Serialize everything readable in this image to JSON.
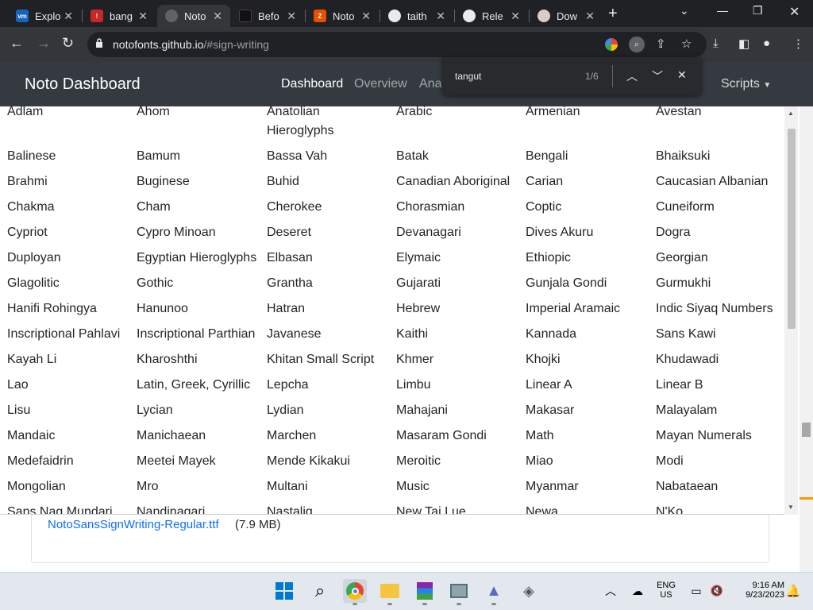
{
  "tabs": [
    {
      "title": "Explo",
      "icon": "vmware-icon",
      "color": "#1565c0"
    },
    {
      "title": "bang",
      "icon": "bang-icon",
      "color": "#c62828"
    },
    {
      "title": "Noto",
      "icon": "globe-icon",
      "color": "#5f6368"
    },
    {
      "title": "Befo",
      "icon": "shield-icon",
      "color": "#111"
    },
    {
      "title": "Noto",
      "icon": "zoho-icon",
      "color": "#e65100"
    },
    {
      "title": "taith",
      "icon": "github-icon",
      "color": "#e8eaed"
    },
    {
      "title": "Rele",
      "icon": "github-icon",
      "color": "#e8eaed"
    },
    {
      "title": "Dow",
      "icon": "avatar-icon",
      "color": "#d7ccc8"
    }
  ],
  "address": {
    "host": "notofonts.github.io",
    "path": "/#sign-writing"
  },
  "navbar": {
    "brand": "Noto Dashboard",
    "links": [
      "Dashboard",
      "Overview",
      "Anal"
    ],
    "scripts": "Scripts"
  },
  "find": {
    "query": "tangut",
    "count": "1/6"
  },
  "scripts_menu": [
    [
      "Adlam",
      "Ahom",
      "Anatolian",
      "Arabic",
      "Armenian",
      "Avestan"
    ],
    [
      "",
      "",
      "Hieroglyphs",
      "",
      "",
      ""
    ],
    [
      "Balinese",
      "Bamum",
      "Bassa Vah",
      "Batak",
      "Bengali",
      "Bhaiksuki"
    ],
    [
      "Brahmi",
      "Buginese",
      "Buhid",
      "Canadian Aboriginal",
      "Carian",
      "Caucasian Albanian"
    ],
    [
      "Chakma",
      "Cham",
      "Cherokee",
      "Chorasmian",
      "Coptic",
      "Cuneiform"
    ],
    [
      "Cypriot",
      "Cypro Minoan",
      "Deseret",
      "Devanagari",
      "Dives Akuru",
      "Dogra"
    ],
    [
      "Duployan",
      "Egyptian Hieroglyphs",
      "Elbasan",
      "Elymaic",
      "Ethiopic",
      "Georgian"
    ],
    [
      "Glagolitic",
      "Gothic",
      "Grantha",
      "Gujarati",
      "Gunjala Gondi",
      "Gurmukhi"
    ],
    [
      "Hanifi Rohingya",
      "Hanunoo",
      "Hatran",
      "Hebrew",
      "Imperial Aramaic",
      "Indic Siyaq Numbers"
    ],
    [
      "Inscriptional Pahlavi",
      "Inscriptional Parthian",
      "Javanese",
      "Kaithi",
      "Kannada",
      "Sans Kawi"
    ],
    [
      "Kayah Li",
      "Kharoshthi",
      "Khitan Small Script",
      "Khmer",
      "Khojki",
      "Khudawadi"
    ],
    [
      "Lao",
      "Latin, Greek, Cyrillic",
      "Lepcha",
      "Limbu",
      "Linear A",
      "Linear B"
    ],
    [
      "Lisu",
      "Lycian",
      "Lydian",
      "Mahajani",
      "Makasar",
      "Malayalam"
    ],
    [
      "Mandaic",
      "Manichaean",
      "Marchen",
      "Masaram Gondi",
      "Math",
      "Mayan Numerals"
    ],
    [
      "Medefaidrin",
      "Meetei Mayek",
      "Mende Kikakui",
      "Meroitic",
      "Miao",
      "Modi"
    ],
    [
      "Mongolian",
      "Mro",
      "Multani",
      "Music",
      "Myanmar",
      "Nabataean"
    ],
    [
      "Sans Nag Mundari",
      "Nandinagari",
      "Nastaliq",
      "New Tai Lue",
      "Newa",
      "N'Ko"
    ]
  ],
  "file": {
    "link": "NotoSansSignWriting-Regular.ttf",
    "size": "(7.9 MB)"
  },
  "tray": {
    "lang": "ENG",
    "region": "US",
    "time": "9:16 AM",
    "date": "9/23/2023"
  }
}
